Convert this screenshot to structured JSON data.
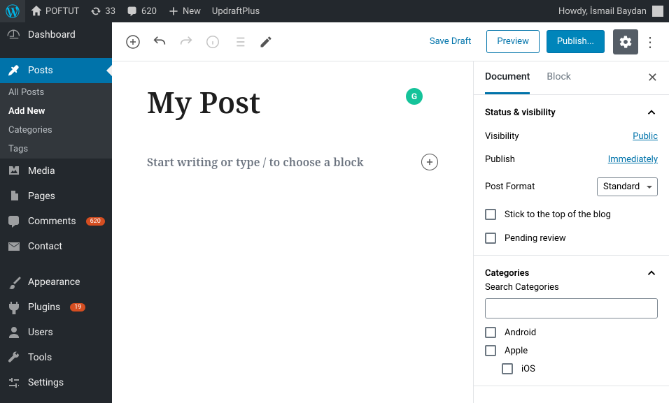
{
  "adminbar": {
    "site_name": "POFTUT",
    "updates": "33",
    "comments": "620",
    "new_label": "New",
    "plugin_label": "UpdraftPlus",
    "howdy": "Howdy, İsmail Baydan"
  },
  "sidebar": {
    "dashboard": "Dashboard",
    "posts": "Posts",
    "posts_sub": {
      "all": "All Posts",
      "add": "Add New",
      "cats": "Categories",
      "tags": "Tags"
    },
    "media": "Media",
    "pages": "Pages",
    "comments": "Comments",
    "comments_badge": "620",
    "contact": "Contact",
    "appearance": "Appearance",
    "plugins": "Plugins",
    "plugins_badge": "19",
    "users": "Users",
    "tools": "Tools",
    "settings": "Settings"
  },
  "toolbar": {
    "save_draft": "Save Draft",
    "preview": "Preview",
    "publish": "Publish..."
  },
  "editor": {
    "title": "My Post",
    "placeholder": "Start writing or type / to choose a block",
    "grammarly": "G"
  },
  "panel": {
    "tab_document": "Document",
    "tab_block": "Block",
    "status_heading": "Status & visibility",
    "visibility_label": "Visibility",
    "visibility_value": "Public",
    "publish_label": "Publish",
    "publish_value": "Immediately",
    "format_label": "Post Format",
    "format_value": "Standard",
    "stick": "Stick to the top of the blog",
    "pending": "Pending review",
    "cats_heading": "Categories",
    "search_cats": "Search Categories",
    "cat1": "Android",
    "cat2": "Apple",
    "cat3": "iOS"
  }
}
